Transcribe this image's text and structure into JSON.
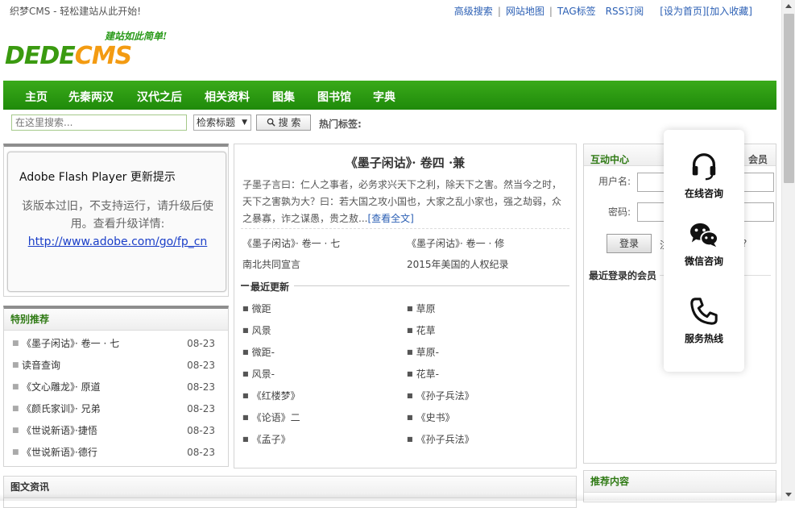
{
  "topbar": {
    "tagline": "织梦CMS - 轻松建站从此开始!",
    "links": [
      "高级搜索",
      "网站地图",
      "TAG标签",
      "RSS订阅"
    ],
    "set_home": "[设为首页]",
    "favorite": "[加入收藏]"
  },
  "logo": {
    "slogan": "建站如此简单!",
    "word_green": "DEDE",
    "word_orange": "CMS"
  },
  "nav": {
    "items": [
      "主页",
      "先秦两汉",
      "汉代之后",
      "相关资料",
      "图集",
      "图书馆",
      "字典"
    ],
    "colors": {
      "green": "#2a9912",
      "orange": "#f39b12"
    }
  },
  "search": {
    "placeholder": "在这里搜索...",
    "select_value": "检索标题",
    "button_label": "搜 索",
    "hot_tags_label": "热门标签:"
  },
  "flash": {
    "title": "Adobe Flash Player 更新提示",
    "body": "该版本过旧，不支持运行，请升级后使用。查看升级详情:",
    "link": "http://www.adobe.com/go/fp_cn"
  },
  "special": {
    "title": "特别推荐",
    "items": [
      {
        "title": "《墨子闲诂》· 卷一 · 七",
        "date": "08-23"
      },
      {
        "title": "读音查询",
        "date": "08-23"
      },
      {
        "title": "《文心雕龙》· 原道",
        "date": "08-23"
      },
      {
        "title": "《颜氏家训》· 兄弟",
        "date": "08-23"
      },
      {
        "title": "《世说新语》·捷悟",
        "date": "08-23"
      },
      {
        "title": "《世说新语》·德行",
        "date": "08-23"
      }
    ]
  },
  "pic_news": {
    "title": "图文资讯"
  },
  "article": {
    "title": "《墨子闲诂》· 卷四 ·兼",
    "excerpt": "子墨子言曰：仁人之事者，必务求兴天下之利，除天下之害。然当今之时，天下之害孰为大？曰：若大国之攻小国也，大家之乱小家也，强之劫弱，众之暴寡，诈之谋愚，贵之敖...",
    "more": "[查看全文]",
    "related": [
      "《墨子闲诂》· 卷一 · 七",
      "《墨子闲诂》· 卷一 · 修",
      "南北共同宣言",
      "2015年美国的人权纪录"
    ],
    "latest_title": "最近更新",
    "latest_left": [
      "微距",
      "风景",
      "微距-",
      "风景-",
      "《红楼梦》",
      "《论语》二",
      "《孟子》"
    ],
    "latest_right": [
      "草原",
      "花草",
      "草原-",
      "花草-",
      "《孙子兵法》",
      "《史书》",
      "《孙子兵法》"
    ]
  },
  "interaction": {
    "title": "互动中心",
    "tab_member": "会员",
    "username_label": "用户名:",
    "password_label": "密码:",
    "login_button": "登录",
    "register_frag_a": "注",
    "register_frag_b": "?",
    "recent_members": "最近登录的会员"
  },
  "recommend": {
    "title": "推荐内容"
  },
  "float_widget": {
    "items": [
      {
        "icon": "headset-icon",
        "label": "在线咨询"
      },
      {
        "icon": "wechat-icon",
        "label": "微信咨询"
      },
      {
        "icon": "phone-icon",
        "label": "服务热线"
      }
    ]
  }
}
